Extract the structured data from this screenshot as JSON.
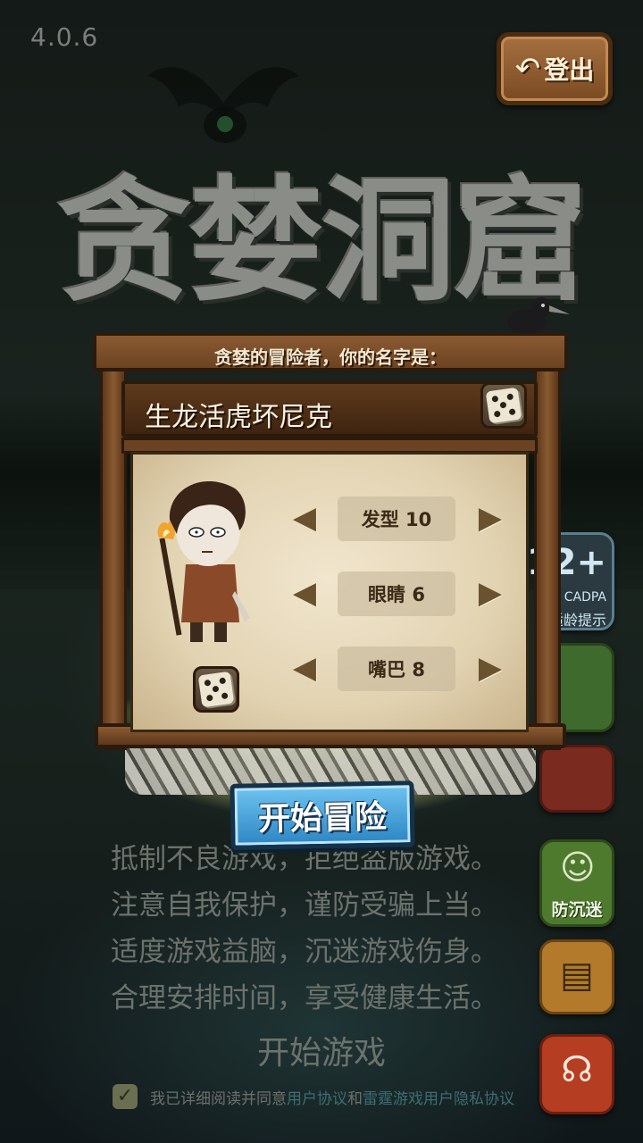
{
  "version": "4.0.6",
  "header": {
    "logout_label": "登出",
    "logout_icon": "back-arrow-icon"
  },
  "title": "贪婪洞窟",
  "notice_lines": [
    "抵制不良游戏，拒绝盗版游戏。",
    "注意自我保护，谨防受骗上当。",
    "适度游戏益脑，沉迷游戏伤身。",
    "合理安排时间，享受健康生活。"
  ],
  "start_game_label": "开始游戏",
  "agreement": {
    "prefix": "我已详细阅读并同意",
    "link1": "用户协议",
    "and": "和",
    "link2": "雷霆游戏用户隐私协议",
    "checked": true
  },
  "side_buttons": {
    "age_big": "12+",
    "age_mid": "CADPA",
    "age_low": "适龄提示",
    "anti_addiction": "防沉迷"
  },
  "panel": {
    "prompt": "贪婪的冒险者，你的名字是：",
    "player_name": "生龙活虎坏尼克",
    "options": [
      {
        "label": "发型 10"
      },
      {
        "label": "眼睛 6"
      },
      {
        "label": "嘴巴 8"
      }
    ],
    "start_adventure": "开始冒险"
  },
  "colors": {
    "start_button": "#2d86c4",
    "wood": "#6c4322",
    "parchment": "#e2d3b2"
  }
}
